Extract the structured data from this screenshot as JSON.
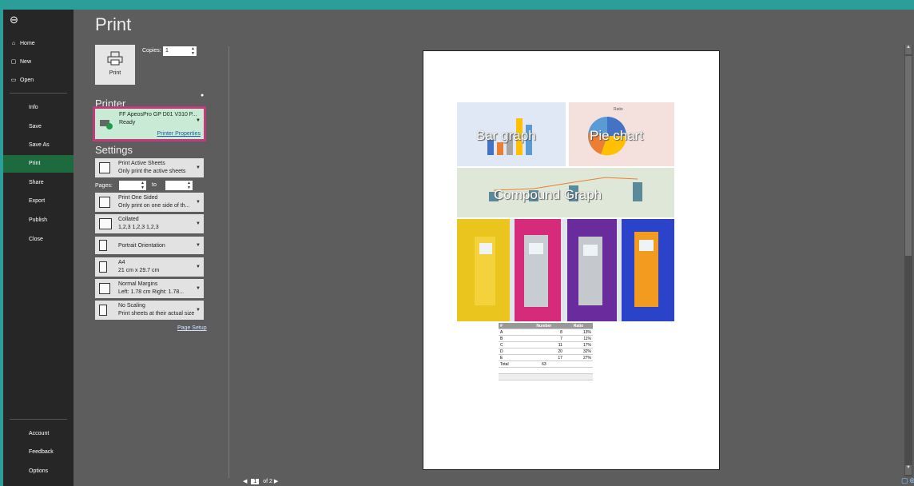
{
  "nav": {
    "items": [
      {
        "label": "Home",
        "icon": "⌂"
      },
      {
        "label": "New",
        "icon": "🗋"
      },
      {
        "label": "Open",
        "icon": "🗁"
      }
    ],
    "sub_items": [
      "Info",
      "Save",
      "Save As",
      "Print",
      "Share",
      "Export",
      "Publish",
      "Close"
    ],
    "bottom_items": [
      "Account",
      "Feedback",
      "Options"
    ],
    "active": "Print"
  },
  "panel": {
    "title": "Print",
    "print_button": "Print",
    "copies_label": "Copies:",
    "copies_value": "1",
    "printer_heading": "Printer",
    "printer": {
      "name": "FF ApeosPro GP D01 V310 P...",
      "status": "Ready",
      "properties": "Printer Properties"
    },
    "settings_heading": "Settings",
    "settings": [
      {
        "l1": "Print Active Sheets",
        "l2": "Only print the active sheets"
      },
      {
        "l1": "Print One Sided",
        "l2": "Only print on one side of th..."
      },
      {
        "l1": "Collated",
        "l2": "1,2,3   1,2,3   1,2,3"
      },
      {
        "l1": "Portrait Orientation",
        "l2": ""
      },
      {
        "l1": "A4",
        "l2": "21 cm x 29.7 cm"
      },
      {
        "l1": "Normal Margins",
        "l2": "Left:  1.78 cm    Right:  1.78..."
      },
      {
        "l1": "No Scaling",
        "l2": "Print sheets at their actual size"
      }
    ],
    "pages_label": "Pages:",
    "to_label": "to",
    "page_setup": "Page Setup"
  },
  "preview": {
    "bar_title": "Bar graph",
    "pie_title": "Pie chart",
    "pie_small_title": "Ratio",
    "compound_title": "Compound Graph",
    "table": {
      "headers": [
        "#",
        "Number",
        "Ratio"
      ],
      "rows": [
        [
          "A",
          "8",
          "13%"
        ],
        [
          "B",
          "7",
          "11%"
        ],
        [
          "C",
          "11",
          "17%"
        ],
        [
          "D",
          "20",
          "32%"
        ],
        [
          "E",
          "17",
          "27%"
        ],
        [
          "Total",
          "63",
          ""
        ]
      ]
    }
  },
  "pager": {
    "current": "1",
    "total": "of 2"
  }
}
